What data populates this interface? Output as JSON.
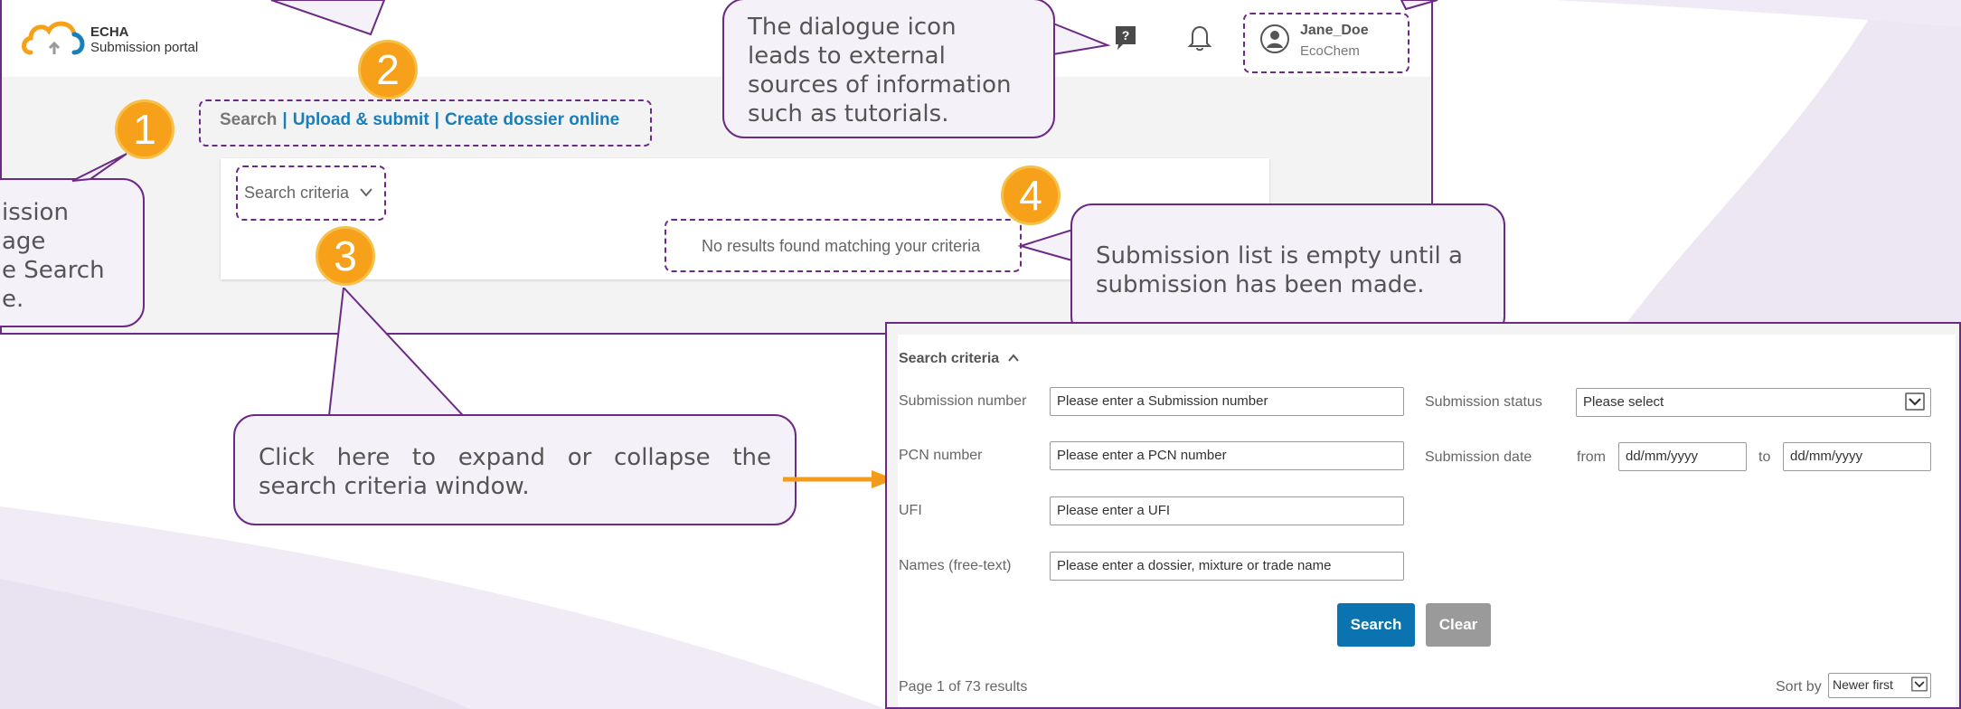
{
  "portal": {
    "logo_line1": "ECHA",
    "logo_line2": "Submission portal",
    "nav": {
      "search": "Search",
      "upload": "Upload & submit",
      "create": "Create dossier online",
      "sep": "|"
    },
    "user": {
      "name": "Jane_Doe",
      "org": "EcoChem"
    },
    "search_criteria_label": "Search criteria",
    "no_results": "No results found matching your criteria"
  },
  "badges": [
    "1",
    "2",
    "3",
    "4"
  ],
  "callouts": {
    "left_lines": [
      "ission",
      "age",
      "e Search",
      "e."
    ],
    "dialogue": [
      "The dialogue icon",
      "leads to external",
      "sources of information",
      "such as tutorials."
    ],
    "empty_list": [
      "Submission list is empty until a",
      "submission has been made."
    ],
    "expand": [
      "Click here to expand or collapse the",
      "search criteria window."
    ]
  },
  "panel": {
    "title": "Search criteria",
    "submission_number_label": "Submission number",
    "submission_number_placeholder": "Please enter a Submission number",
    "submission_status_label": "Submission status",
    "submission_status_value": "Please select",
    "pcn_label": "PCN number",
    "pcn_placeholder": "Please enter a PCN number",
    "submission_date_label": "Submission date",
    "from_label": "from",
    "from_placeholder": "dd/mm/yyyy",
    "to_label": "to",
    "to_placeholder": "dd/mm/yyyy",
    "ufi_label": "UFI",
    "ufi_placeholder": "Please enter a UFI",
    "names_label": "Names (free-text)",
    "names_placeholder": "Please enter a dossier, mixture or trade name",
    "search_button": "Search",
    "clear_button": "Clear",
    "page_info": "Page 1 of 73 results",
    "sort_label": "Sort by",
    "sort_value": "Newer first"
  },
  "colors": {
    "accent_purple": "#6b2a84",
    "badge_orange": "#f7a11a",
    "link_blue": "#1a7eb8",
    "search_btn": "#0a73b0",
    "clear_btn": "#9a9a9a",
    "arrow_orange": "#f59b1c"
  },
  "icons": [
    "cloud-logo-icon",
    "help-dialogue-icon",
    "bell-icon",
    "user-avatar-icon",
    "chevron-down-icon",
    "chevron-up-icon",
    "select-arrow-icon"
  ]
}
